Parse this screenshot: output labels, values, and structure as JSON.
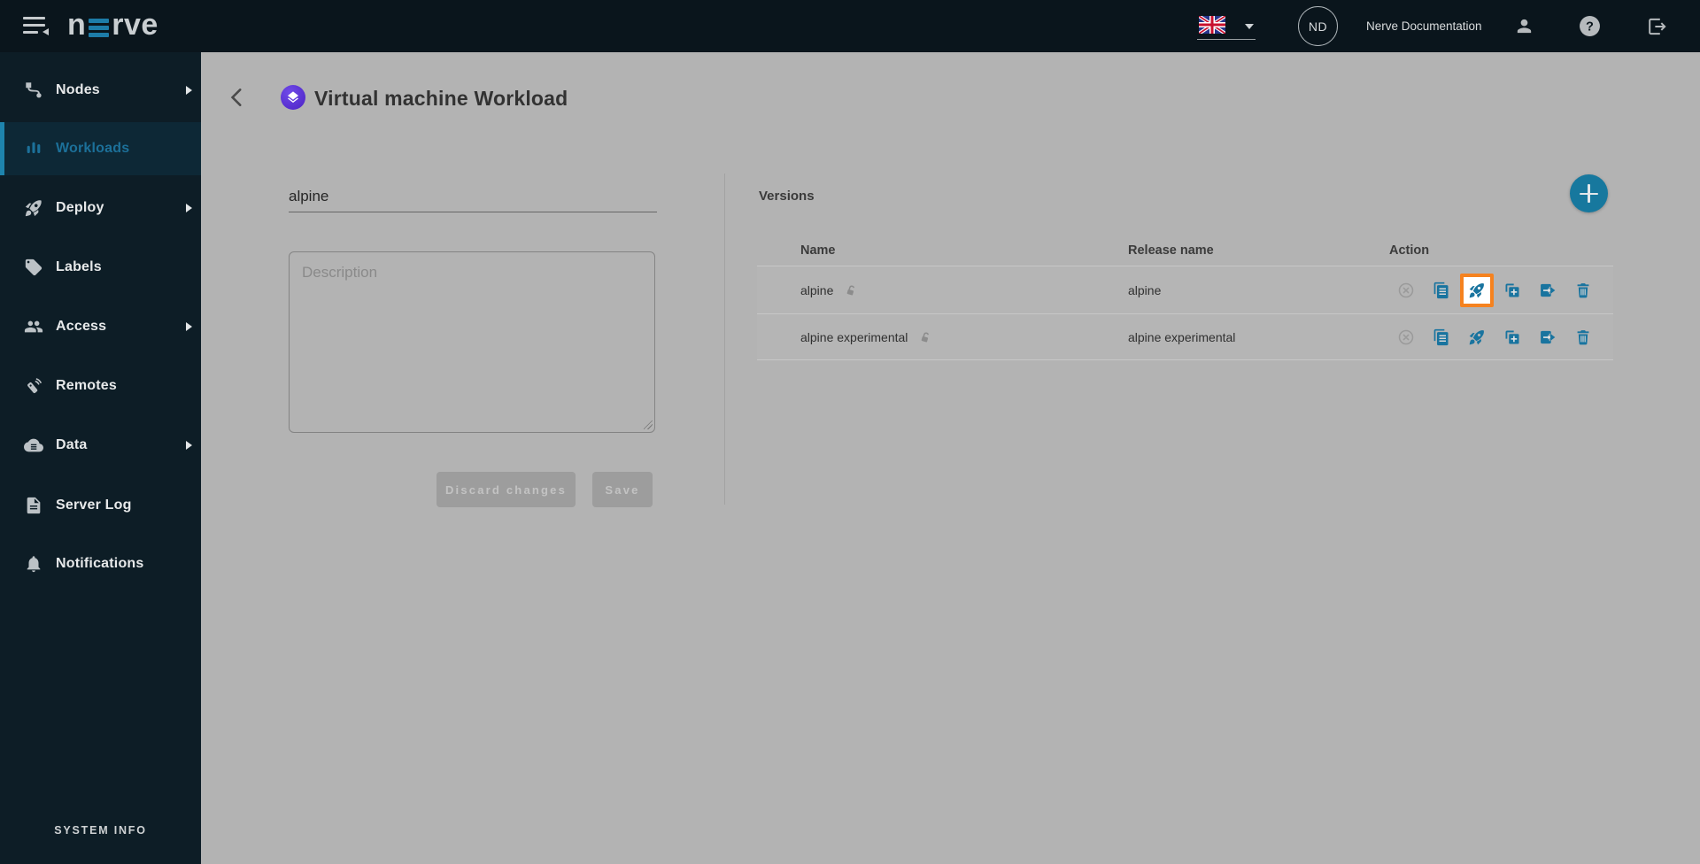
{
  "header": {
    "logo_text": "nerve",
    "logo_prefix": "n",
    "logo_suffix": "rve",
    "language_code": "en-GB",
    "avatar_initials": "ND",
    "documentation_label": "Nerve Documentation"
  },
  "sidebar": {
    "items": [
      {
        "label": "Nodes",
        "expandable": true,
        "active": false
      },
      {
        "label": "Workloads",
        "expandable": false,
        "active": true
      },
      {
        "label": "Deploy",
        "expandable": true,
        "active": false
      },
      {
        "label": "Labels",
        "expandable": false,
        "active": false
      },
      {
        "label": "Access",
        "expandable": true,
        "active": false
      },
      {
        "label": "Remotes",
        "expandable": false,
        "active": false
      },
      {
        "label": "Data",
        "expandable": true,
        "active": false
      },
      {
        "label": "Server Log",
        "expandable": false,
        "active": false
      },
      {
        "label": "Notifications",
        "expandable": false,
        "active": false
      }
    ],
    "footer_label": "SYSTEM INFO"
  },
  "main": {
    "page_title": "Virtual machine Workload",
    "form": {
      "name_value": "alpine",
      "description_placeholder": "Description",
      "discard_label": "Discard changes",
      "save_label": "Save"
    },
    "versions": {
      "title": "Versions",
      "columns": {
        "name": "Name",
        "release": "Release name",
        "action": "Action"
      },
      "rows": [
        {
          "name": "alpine",
          "release": "alpine",
          "deploy_highlighted": true
        },
        {
          "name": "alpine experimental",
          "release": "alpine experimental",
          "deploy_highlighted": false
        }
      ]
    }
  },
  "icons": {
    "actions": [
      "undeploy-icon",
      "copy-icon",
      "deploy-rocket-icon",
      "duplicate-icon",
      "export-icon",
      "delete-icon"
    ]
  },
  "colors": {
    "accent_blue": "#19749f",
    "fab_blue": "#17789e",
    "highlight_orange": "#f5821f",
    "workload_purple": "#5531d3",
    "header_bg": "#0a151c",
    "sidebar_bg": "#0d1d26",
    "page_bg": "#b3b3b3"
  }
}
